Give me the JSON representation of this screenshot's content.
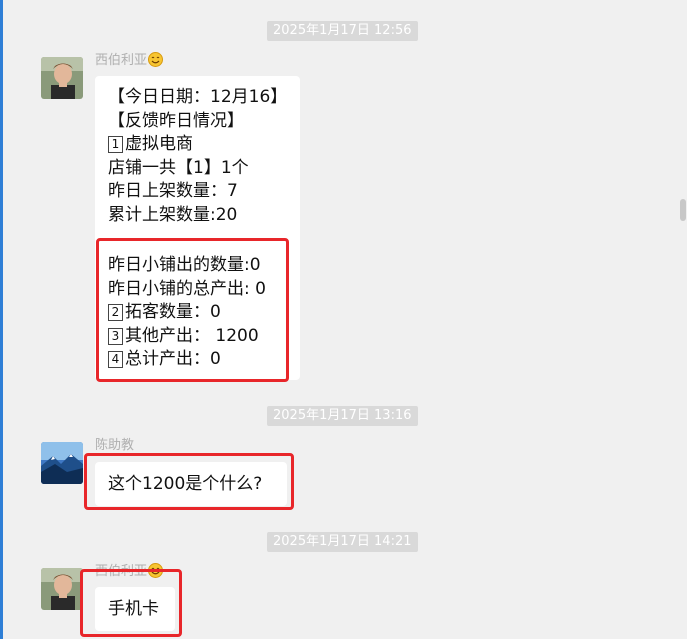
{
  "chat": {
    "messages": [
      {
        "timestamp": "2025年1月17日 12:56",
        "sender": "西伯利亚",
        "sender_emoji": "smile-emoji",
        "lines_top": [
          {
            "prefix": "",
            "text": "【今日日期：12月16】"
          },
          {
            "prefix": "",
            "text": "【反馈昨日情况】"
          },
          {
            "prefix": "1",
            "text": "虚拟电商"
          },
          {
            "prefix": "",
            "text": "店铺一共【1】1个"
          },
          {
            "prefix": "",
            "text": "昨日上架数量：7"
          },
          {
            "prefix": "",
            "text": "累计上架数量:20"
          }
        ],
        "lines_bottom": [
          {
            "prefix": "",
            "text": "昨日小铺出的数量:0"
          },
          {
            "prefix": "",
            "text": "昨日小铺的总产出: 0"
          },
          {
            "prefix": "2",
            "text": "拓客数量：0"
          },
          {
            "prefix": "3",
            "text": "其他产出：  1200"
          },
          {
            "prefix": "4",
            "text": "总计产出：0"
          }
        ]
      },
      {
        "timestamp": "2025年1月17日 13:16",
        "sender": "陈助教",
        "text": "这个1200是个什么?"
      },
      {
        "timestamp": "2025年1月17日 14:21",
        "sender": "西伯利亚",
        "sender_emoji": "smile-emoji",
        "text": "手机卡"
      }
    ]
  },
  "colors": {
    "background": "#f0f0f0",
    "bubble": "#ffffff",
    "highlight_frame": "#e8262a",
    "timestamp_pill": "#d9d9d9"
  }
}
